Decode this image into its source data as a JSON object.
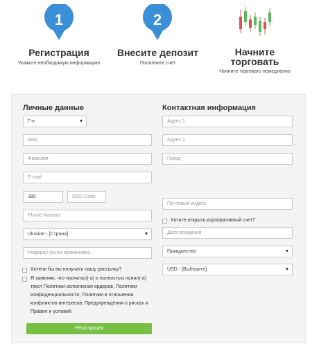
{
  "steps": [
    {
      "number": "1",
      "title": "Регистрация",
      "subtitle": "Укажите необходимую информацию"
    },
    {
      "number": "2",
      "title": "Внесите депозит",
      "subtitle": "Пополните счет"
    },
    {
      "title_line1": "Начните",
      "title_line2": "торговать",
      "subtitle": "Начните торговать немедленно"
    }
  ],
  "personal": {
    "title": "Личные данные",
    "title_select": "Г-н",
    "first_name_placeholder": "Имя",
    "last_name_placeholder": "Фамилия",
    "email_placeholder": "E-mail",
    "country_code": "380",
    "ddd_placeholder": "DDD Code",
    "phone_placeholder": "Phone Number",
    "country_select": "Ukraine - [Страна]",
    "referral_placeholder": "Реферал (если применимо)",
    "newsletter_label": "Хотели бы вы получать нашу рассылку?",
    "agree_lines": [
      "Я заявляю, что прочитал(-а) и полностью понял(-а)",
      "текст Политики исполнения ордеров, Политики",
      "конфиденциальности, Политики в отношении",
      "конфликтов интересов, Предупреждения о рисках и",
      "Правил и условий."
    ],
    "register_button": "Регистрация"
  },
  "contact": {
    "title": "Контактная информация",
    "address1_placeholder": "Адрес 1",
    "address2_placeholder": "Адрес 2",
    "city_placeholder": "Город",
    "postcode_placeholder": "Почтовый индекс",
    "corporate_label": "Хотите открыть корпоративный счет?",
    "birthdate_placeholder": "Дата рождения",
    "citizenship_select": "Гражданство",
    "currency_select": "USD - [Выберите]"
  },
  "colors": {
    "accent_blue": "#3a8fd6",
    "button_green": "#77c043",
    "candle_green": "#5cb85c",
    "candle_red": "#d9534f"
  },
  "icons": [
    "step-1-pin-icon",
    "step-2-pin-icon",
    "candlestick-chart-icon"
  ]
}
